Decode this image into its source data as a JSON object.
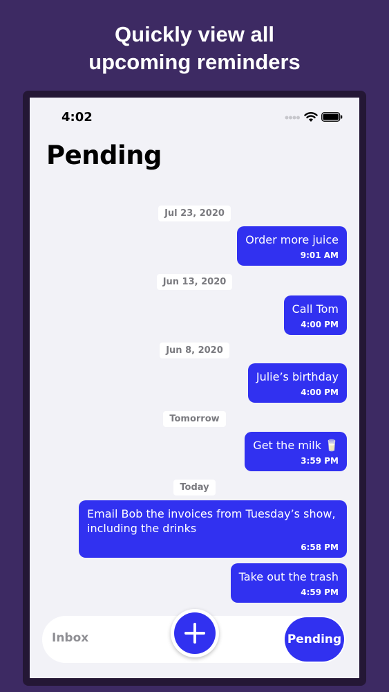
{
  "headline": {
    "line1": "Quickly view all",
    "line2": "upcoming reminders"
  },
  "status_bar": {
    "time": "4:02"
  },
  "page_title": "Pending",
  "colors": {
    "background": "#3d2a63",
    "accent": "#3131f0",
    "screen": "#f2f2f7"
  },
  "groups": [
    {
      "date": "Jul 23, 2020",
      "reminders": [
        {
          "text": "Order more juice",
          "time": "9:01 AM"
        }
      ]
    },
    {
      "date": "Jun 13, 2020",
      "reminders": [
        {
          "text": "Call Tom",
          "time": "4:00 PM"
        }
      ]
    },
    {
      "date": "Jun 8, 2020",
      "reminders": [
        {
          "text": "Julie’s birthday",
          "time": "4:00 PM"
        }
      ]
    },
    {
      "date": "Tomorrow",
      "reminders": [
        {
          "text": "Get the milk 🥛",
          "time": "3:59 PM"
        }
      ]
    },
    {
      "date": "Today",
      "reminders": [
        {
          "text": "Email Bob the invoices from Tuesday’s show, including the drinks",
          "time": "6:58 PM"
        },
        {
          "text": "Take out the trash",
          "time": "4:59 PM"
        }
      ]
    }
  ],
  "tabbar": {
    "inbox_label": "Inbox",
    "pending_label": "Pending",
    "add_icon": "plus-icon"
  }
}
